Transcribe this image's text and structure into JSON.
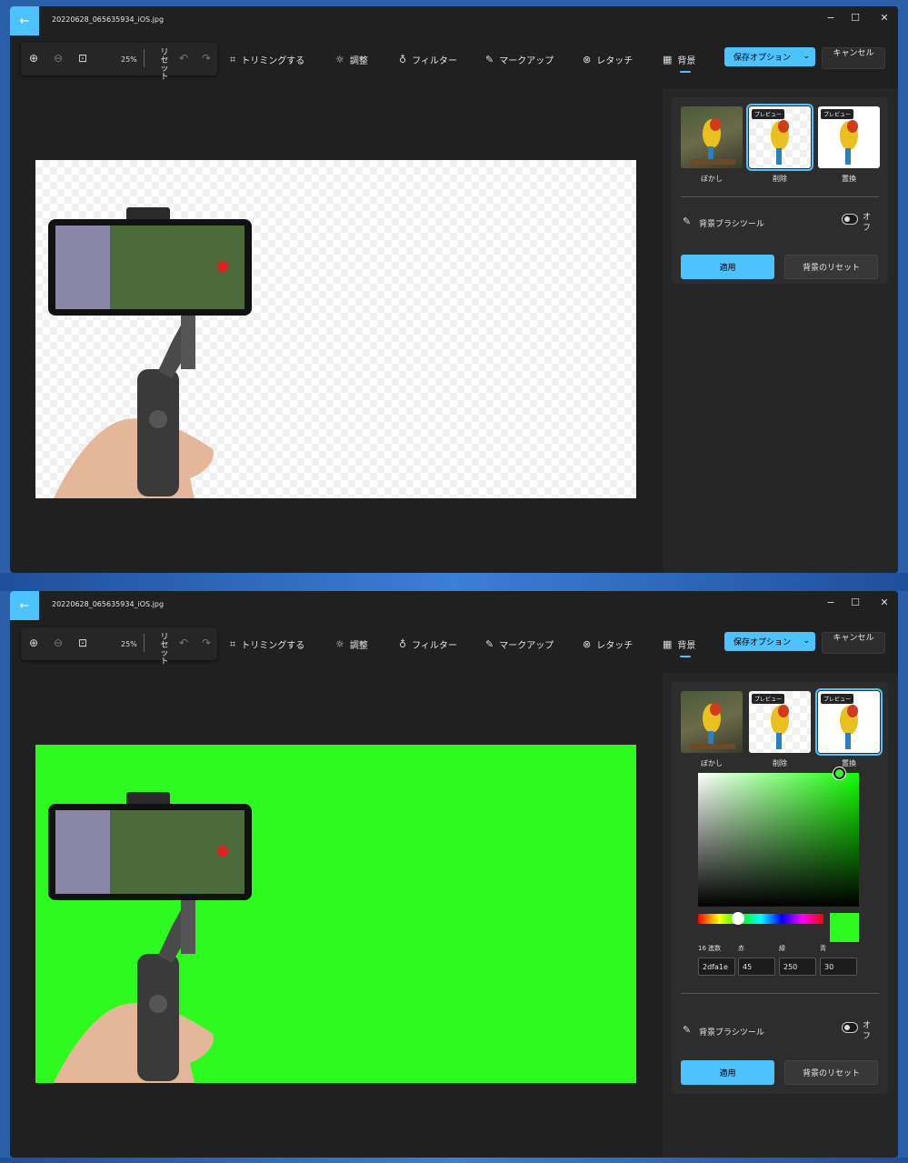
{
  "window": {
    "file_title": "20220628_065635934_iOS.jpg",
    "back_icon": "←",
    "minimize_icon": "−",
    "maximize_icon": "☐",
    "close_icon": "✕"
  },
  "toolbar": {
    "zoom_in_icon": "⊕",
    "zoom_out_icon": "⊖",
    "actual_size_icon": "⊡",
    "zoom_level": "25%",
    "reset_label": "リセット",
    "undo_icon": "↶",
    "redo_icon": "↷",
    "tools": [
      {
        "icon": "⌗",
        "label": "トリミングする"
      },
      {
        "icon": "☼",
        "label": "調整"
      },
      {
        "icon": "♁",
        "label": "フィルター"
      },
      {
        "icon": "✎",
        "label": "マークアップ"
      },
      {
        "icon": "⊗",
        "label": "レタッチ"
      },
      {
        "icon": "▦",
        "label": "背景"
      }
    ],
    "save_label": "保存オプション",
    "save_chevron": "⌄",
    "cancel_label": "キャンセル"
  },
  "panel": {
    "options": [
      {
        "label": "ぼかし",
        "tag": ""
      },
      {
        "label": "削除",
        "tag": "プレビュー"
      },
      {
        "label": "置換",
        "tag": "プレビュー"
      }
    ],
    "brush_icon": "✎",
    "brush_tool_label": "背景ブラシツール",
    "brush_toggle_state": "オフ",
    "apply_label": "適用",
    "reset_bg_label": "背景のリセット"
  },
  "screen1": {
    "selected_option": "削除",
    "background": "transparent"
  },
  "screen2": {
    "selected_option": "置換",
    "background_color": "#2dfa1e",
    "color_picker": {
      "hex_label": "16 進数",
      "red_label": "赤",
      "green_label": "緑",
      "blue_label": "青",
      "hex": "2dfa1e",
      "red": "45",
      "green": "250",
      "blue": "30"
    }
  },
  "colors": {
    "accent": "#4cc2ff",
    "replacement": "#2dfa1e",
    "window_bg": "#202020",
    "panel_bg": "#262626"
  }
}
